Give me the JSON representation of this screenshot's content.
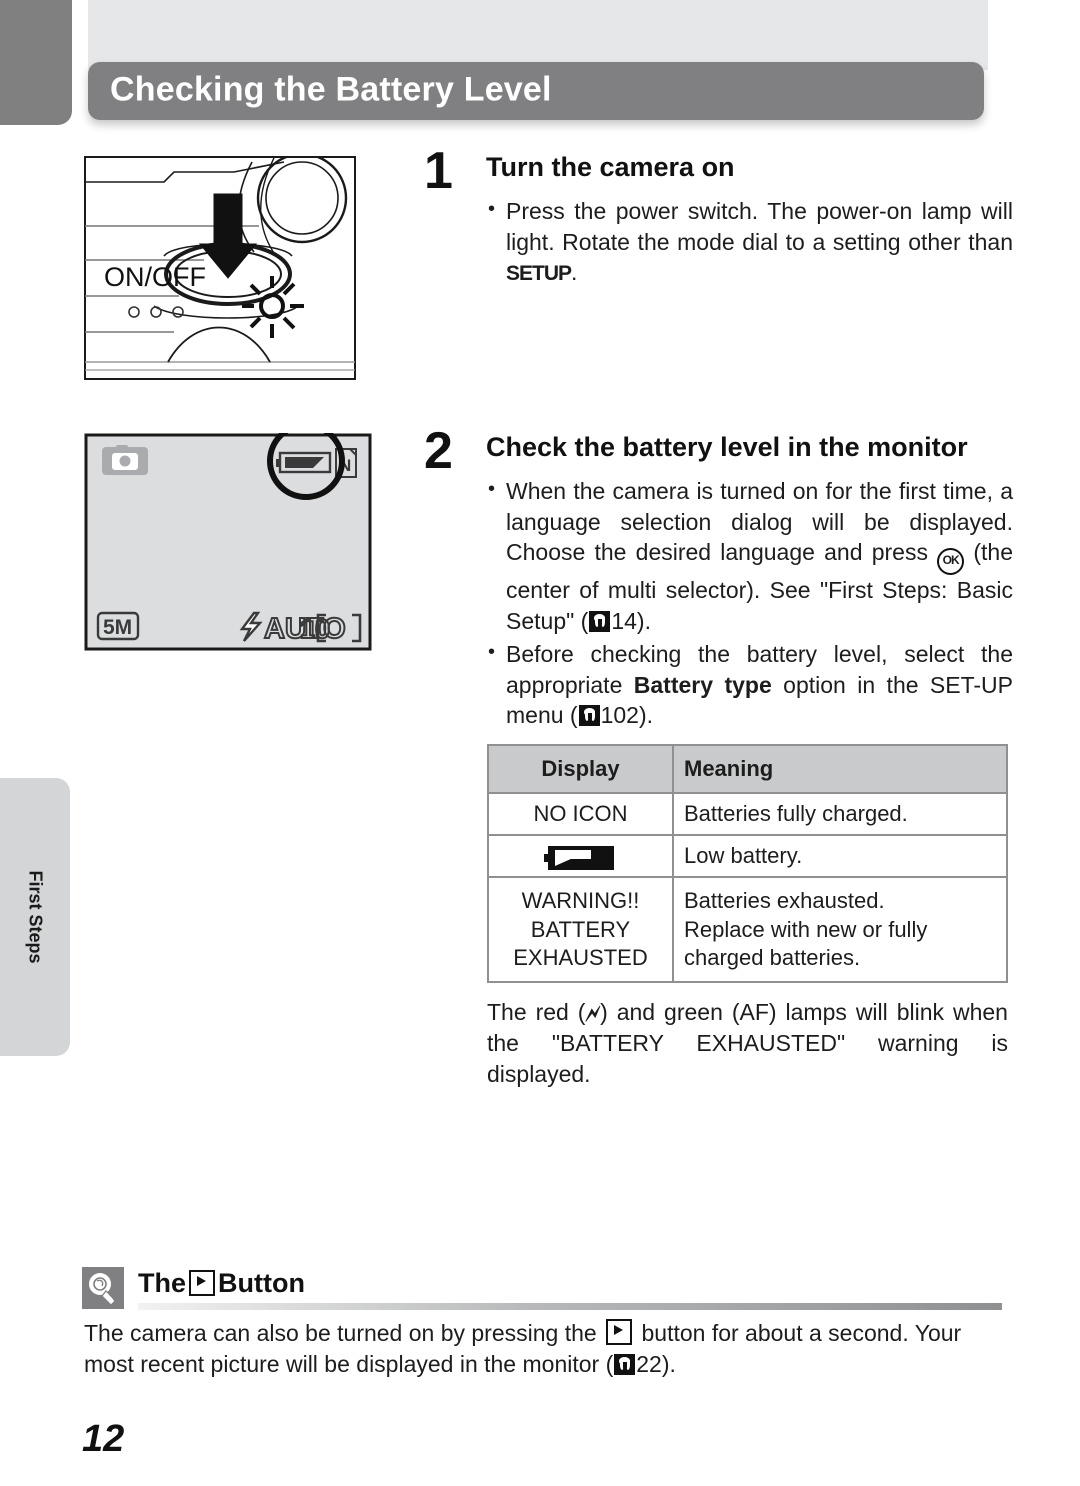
{
  "header": {
    "title": "Checking the Battery Level"
  },
  "side_tab": {
    "label": "First Steps"
  },
  "illustrations": {
    "camera": {
      "name": "camera-top-view",
      "onoff_label": "ON/OFF"
    },
    "monitor": {
      "name": "camera-monitor-view",
      "image_size": "5M",
      "flash_mode": "AUTO",
      "frames_remaining": "[ 10]"
    }
  },
  "steps": [
    {
      "number": "1",
      "heading": "Turn the camera on",
      "bullets": [
        {
          "prefix": "Press the power switch. The power-on lamp will light. Rotate the mode dial to a setting other than ",
          "lcd": "SETUP",
          "suffix": "."
        }
      ]
    },
    {
      "number": "2",
      "heading": "Check the battery level in the monitor",
      "bullets": [
        {
          "part1": "When the camera is turned on for the first time, a language selection dialog will be displayed. Choose the desired language and press ",
          "ok_glyph": "OK",
          "part2": " (the center of multi selector). See \"First Steps: Basic Setup\" (",
          "ref_page": "14",
          "part3": ")."
        },
        {
          "part1": "Before checking the battery level, select the appropriate ",
          "bold": "Battery type",
          "part2": " option in the SET-UP menu (",
          "ref_page": "102",
          "part3": ")."
        }
      ]
    }
  ],
  "table": {
    "headers": [
      "Display",
      "Meaning"
    ],
    "rows": [
      {
        "display": "NO ICON",
        "display_is_icon": false,
        "meaning": "Batteries fully charged."
      },
      {
        "display": "low-battery-icon",
        "display_is_icon": true,
        "meaning": "Low battery."
      },
      {
        "display": "WARNING!!\nBATTERY\nEXHAUSTED",
        "display_is_icon": false,
        "meaning": "Batteries exhausted.\nReplace with new or fully charged batteries."
      }
    ]
  },
  "after_table": {
    "part1": "The red (",
    "bolt": "⚡",
    "part2": ") and green (AF) lamps will blink when the \"BATTERY EXHAUSTED\" warning is displayed."
  },
  "tip": {
    "heading_before": "The",
    "heading_glyph": "play-button",
    "heading_after": "Button",
    "body_part1": "The camera can also be turned on by pressing the ",
    "body_part2": " button for about a second. Your most recent picture will be displayed in the monitor (",
    "ref_page": "22",
    "body_part3": ")."
  },
  "page_number": "12",
  "colors": {
    "banner": "#808083",
    "side_tab": "#d4d5d6",
    "table_header": "#c9cacb",
    "text": "#1d1d1d"
  }
}
